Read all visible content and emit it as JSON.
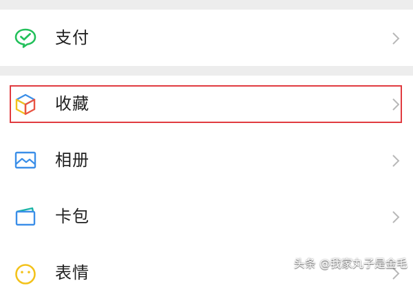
{
  "menu": {
    "items": [
      {
        "label": "支付",
        "icon": "wechat-pay-icon"
      },
      {
        "label": "收藏",
        "icon": "favorites-cube-icon"
      },
      {
        "label": "相册",
        "icon": "album-icon"
      },
      {
        "label": "卡包",
        "icon": "card-wallet-icon"
      },
      {
        "label": "表情",
        "icon": "emoji-icon"
      }
    ],
    "highlighted": "收藏"
  },
  "colors": {
    "background": "#ededed",
    "row": "#ffffff",
    "pay_green": "#22c05a",
    "highlight_red": "#e0393e",
    "blue": "#3a8ee8",
    "teal": "#18b3a5",
    "yellow": "#f3c21b"
  },
  "watermark": "头条 @我家丸子是金毛"
}
